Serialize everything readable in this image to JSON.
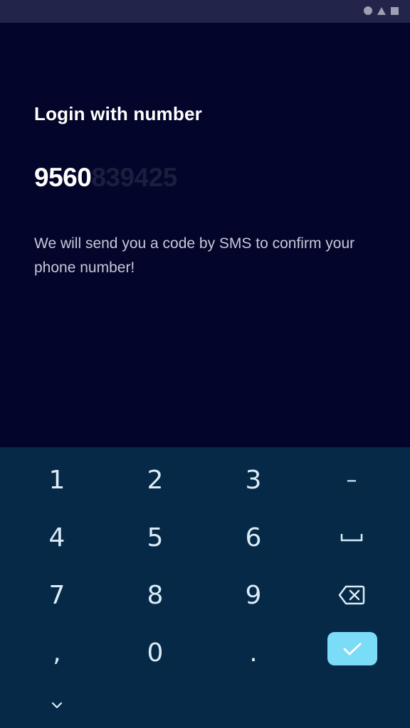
{
  "login": {
    "title": "Login with number",
    "phone_typed": "9560",
    "phone_hint": "839425",
    "info": "We will send you a code by SMS to confirm your phone number!"
  },
  "keyboard": {
    "keys": {
      "k1": "1",
      "k2": "2",
      "k3": "3",
      "dash": "–",
      "k4": "4",
      "k5": "5",
      "k6": "6",
      "k7": "7",
      "k8": "8",
      "k9": "9",
      "comma": ",",
      "k0": "0",
      "period": "."
    },
    "icons": {
      "space": "space-icon",
      "backspace": "backspace-icon",
      "enter": "check-icon",
      "collapse": "chevron-down-icon"
    },
    "colors": {
      "background": "#062947",
      "key_text": "#dcecf7",
      "enter_button": "#7bdcf7"
    }
  },
  "colors": {
    "app_background": "#03052a",
    "status_bar": "#22244a"
  }
}
